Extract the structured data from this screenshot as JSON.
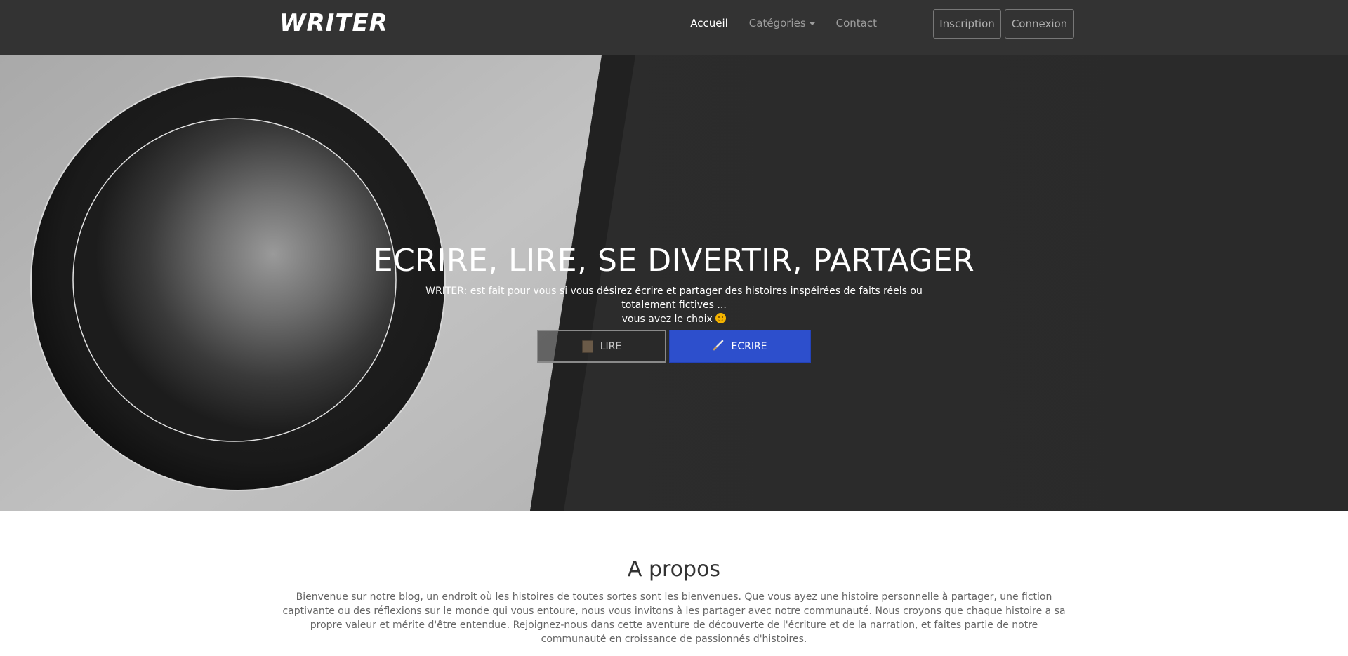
{
  "navbar": {
    "brand": "WRITER",
    "links": [
      {
        "label": "Accueil",
        "active": true
      },
      {
        "label": "Catégories",
        "dropdown": true
      },
      {
        "label": "Contact"
      }
    ],
    "signup_label": "Inscription",
    "login_label": "Connexion"
  },
  "hero": {
    "title": "ECRIRE, LIRE, SE DIVERTIR, PARTAGER",
    "subtitle_line1": "WRITER: est fait pour vous si vous désirez écrire et partager des histoires inspéirées de faits réels ou totalement fictives ...",
    "subtitle_line2": "vous avez le choix",
    "emoji_icon": "smiling-face-icon",
    "read_button": {
      "label": "LIRE",
      "icon": "book-icon"
    },
    "write_button": {
      "label": "ECRIRE",
      "icon": "pen-icon"
    }
  },
  "about": {
    "title": "A propos",
    "text": "Bienvenue sur notre blog, un endroit où les histoires de toutes sortes sont les bienvenues. Que vous ayez une histoire personnelle à partager, une fiction captivante ou des réflexions sur le monde qui vous entoure, nous vous invitons à les partager avec notre communauté. Nous croyons que chaque histoire a sa propre valeur et mérite d'être entendue. Rejoignez-nous dans cette aventure de découverte de l'écriture et de la narration, et faites partie de notre communauté en croissance de passionnés d'histoires."
  },
  "colors": {
    "navbar_bg": "#333333",
    "accent_blue": "#2d4fcc"
  }
}
